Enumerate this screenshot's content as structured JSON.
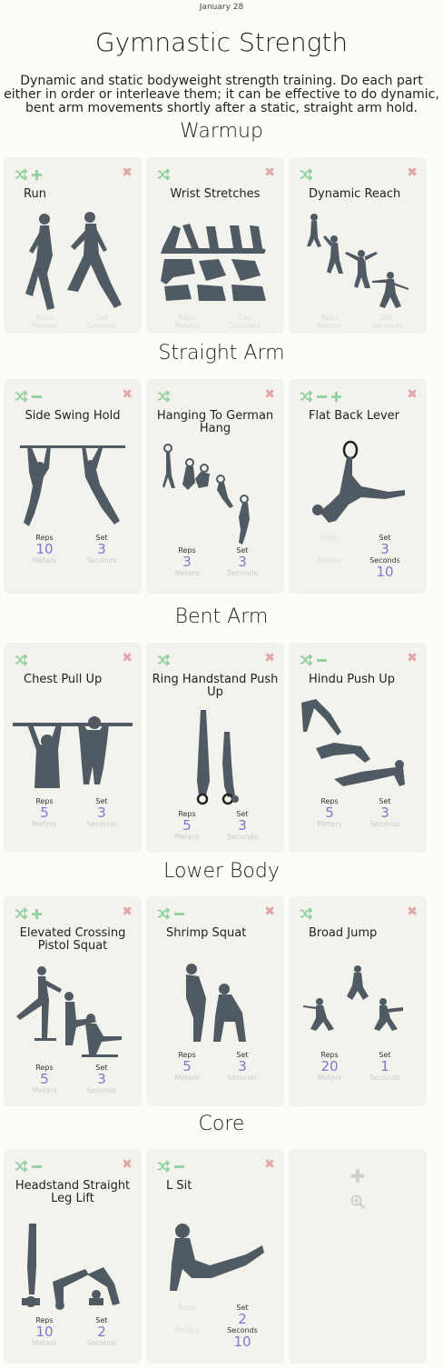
{
  "header": {
    "date": "January 28",
    "title": "Gymnastic Strength",
    "description": "Dynamic and static bodyweight strength training. Do each part either in order or interleave them; it can be effective to do dynamic, bent arm movements shortly after a static, straight arm hold."
  },
  "labels": {
    "reps": "Reps",
    "set": "Set",
    "meters": "Meters",
    "seconds": "Seconds"
  },
  "sections": [
    {
      "title": "Warmup",
      "exercises": [
        {
          "name": "Run"
        },
        {
          "name": "Wrist Stretches"
        },
        {
          "name": "Dynamic Reach"
        }
      ]
    },
    {
      "title": "Straight Arm",
      "exercises": [
        {
          "name": "Side Swing Hold",
          "reps": "10",
          "set": "3"
        },
        {
          "name": "Hanging To German Hang",
          "reps": "3",
          "set": "3"
        },
        {
          "name": "Flat Back Lever",
          "set": "3",
          "seconds": "10"
        }
      ]
    },
    {
      "title": "Bent Arm",
      "exercises": [
        {
          "name": "Chest Pull Up",
          "reps": "5",
          "set": "3"
        },
        {
          "name": "Ring Handstand Push Up",
          "reps": "5",
          "set": "3"
        },
        {
          "name": "Hindu Push Up",
          "reps": "5",
          "set": "3"
        }
      ]
    },
    {
      "title": "Lower Body",
      "exercises": [
        {
          "name": "Elevated Crossing Pistol Squat",
          "reps": "5",
          "set": "3"
        },
        {
          "name": "Shrimp Squat",
          "reps": "5",
          "set": "3"
        },
        {
          "name": "Broad Jump",
          "reps": "20",
          "set": "1"
        }
      ]
    },
    {
      "title": "Core",
      "exercises": [
        {
          "name": "Headstand Straight Leg Lift",
          "reps": "10",
          "set": "2"
        },
        {
          "name": "L Sit",
          "set": "2",
          "seconds": "10"
        }
      ]
    }
  ],
  "colors": {
    "accent_green": "#8fd19e",
    "close_red": "#e0a7a7",
    "value_purple": "#7b79cf",
    "figure": "#4f5a63"
  }
}
